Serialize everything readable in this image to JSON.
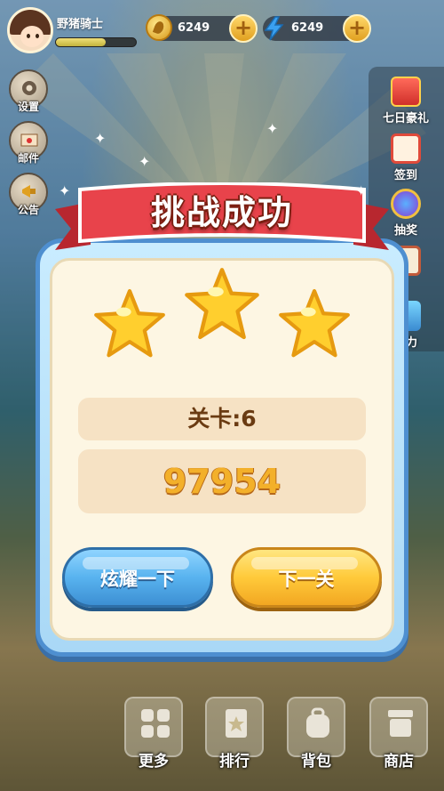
{
  "player": {
    "name": "野猪骑士",
    "xp_progress": 0.62
  },
  "resources": {
    "coins": "6249",
    "energy": "6249"
  },
  "left_menu": [
    {
      "label": "设置"
    },
    {
      "label": "邮件"
    },
    {
      "label": "公告"
    }
  ],
  "right_menu": [
    {
      "label": "七日豪礼"
    },
    {
      "label": "签到"
    },
    {
      "label": "抽奖"
    },
    {
      "label": ""
    },
    {
      "label": "助力"
    }
  ],
  "result": {
    "title": "挑战成功",
    "stars": 3,
    "level": "关卡:6",
    "score": "97954"
  },
  "buttons": {
    "share": "炫耀一下",
    "next": "下一关"
  },
  "bottom_menu": [
    {
      "label": "更多"
    },
    {
      "label": "排行"
    },
    {
      "label": "背包"
    },
    {
      "label": "商店"
    }
  ],
  "colors": {
    "ribbon": "#e8434b",
    "dialog_border": "#4e8fd0",
    "star": "#ffcf2e",
    "score": "#f3b02a"
  }
}
